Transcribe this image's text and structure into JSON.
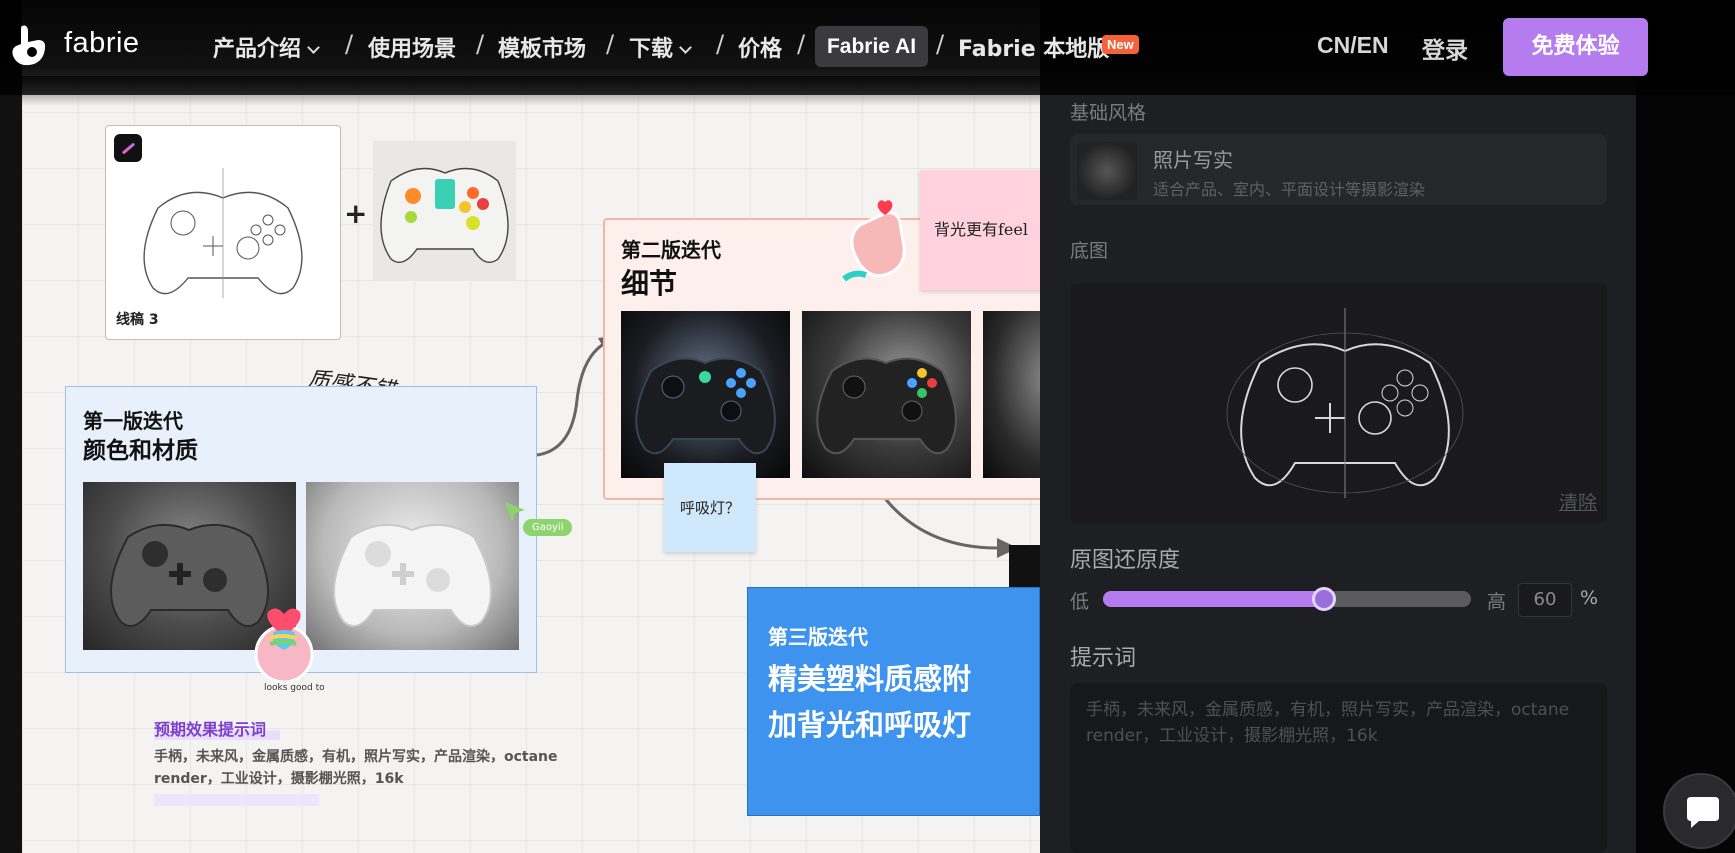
{
  "navbar": {
    "brand": "fabrie",
    "items": [
      {
        "label": "产品介绍"
      },
      {
        "label": "使用场景"
      },
      {
        "label": "模板市场"
      },
      {
        "label": "下载"
      },
      {
        "label": "价格"
      },
      {
        "label": "Fabrie AI"
      },
      {
        "label": "Fabrie 本地版"
      }
    ],
    "separator": "/",
    "new_badge": "New",
    "lang": "CN/EN",
    "login": "登录",
    "cta": "免费体验"
  },
  "canvas": {
    "sketch_caption": "线稿 3",
    "plus": "+",
    "handwriting_note": "质感不错",
    "iteration1": {
      "label": "第一版迭代",
      "title": "颜色和材质"
    },
    "iteration2": {
      "label": "第二版迭代",
      "title": "细节"
    },
    "iteration3": {
      "label": "第三版迭代",
      "title": "精美塑料质感附加背光和呼吸灯"
    },
    "sticky_pink": "背光更有feel",
    "sticky_blue": "呼吸灯？",
    "cursor_user": "Gaoyii",
    "sticker_text": "looks good to me",
    "prompt": {
      "title": "预期效果提示词",
      "text": "手柄，未来风，金属质感，有机，照片写实，产品渲染，octane render，工业设计，摄影棚光照，16k"
    }
  },
  "panel": {
    "style_section_label": "基础风格",
    "style": {
      "name": "照片写实",
      "desc": "适合产品、室内、平面设计等摄影渲染"
    },
    "base_image_label": "底图",
    "clear": "清除",
    "fidelity_title": "原图还原度",
    "slider_low": "低",
    "slider_high": "高",
    "slider_value": "60",
    "slider_fraction": 0.6,
    "slider_unit": "%",
    "prompt_label": "提示词",
    "prompt_placeholder": "手柄，未来风，金属质感，有机，照片写实，产品渲染，octane render，工业设计，摄影棚光照，16k"
  },
  "colors": {
    "accent": "#b57cf0",
    "new_badge": "#f4623a",
    "iteration3_bg": "#3e93ef"
  }
}
